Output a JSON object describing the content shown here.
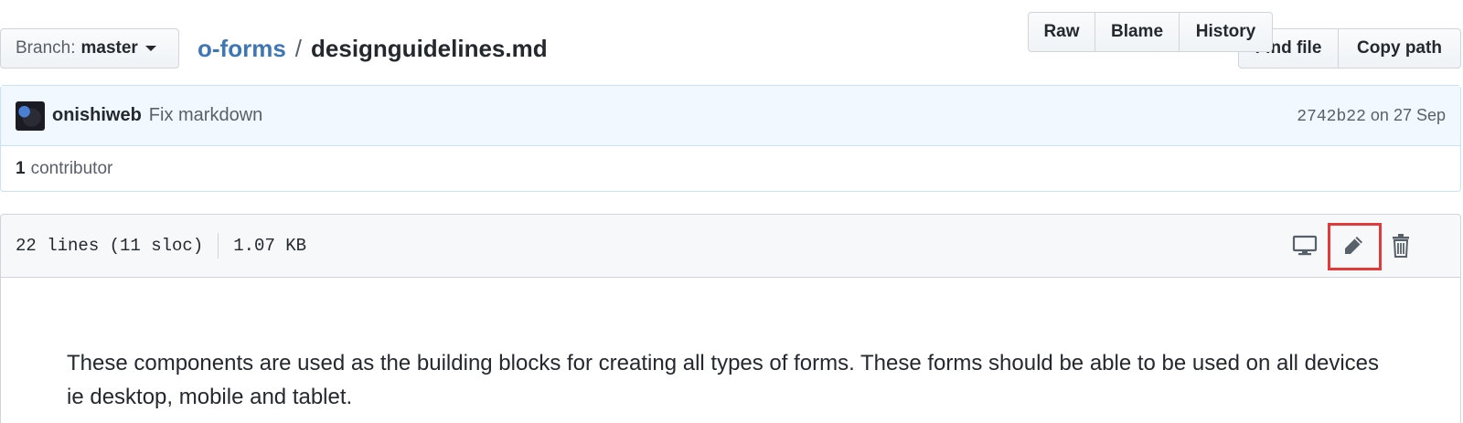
{
  "topbar": {
    "branch_prefix": "Branch:",
    "branch_name": "master",
    "repo": "o-forms",
    "separator": "/",
    "file_name": "designguidelines.md",
    "find_file": "Find file",
    "copy_path": "Copy path"
  },
  "commit": {
    "author": "onishiweb",
    "message": "Fix markdown",
    "sha": "2742b22",
    "date": "on 27 Sep"
  },
  "contributors": {
    "count": "1",
    "label": "contributor"
  },
  "file_header": {
    "lines": "22 lines (11 sloc)",
    "size": "1.07 KB",
    "raw": "Raw",
    "blame": "Blame",
    "history": "History"
  },
  "icons": {
    "desktop": "desktop-icon",
    "edit": "pencil-icon",
    "delete": "trash-icon"
  },
  "content": {
    "paragraph": "These components are used as the building blocks for creating all types of forms. These forms should be able to be used on all devices ie desktop, mobile and tablet."
  }
}
